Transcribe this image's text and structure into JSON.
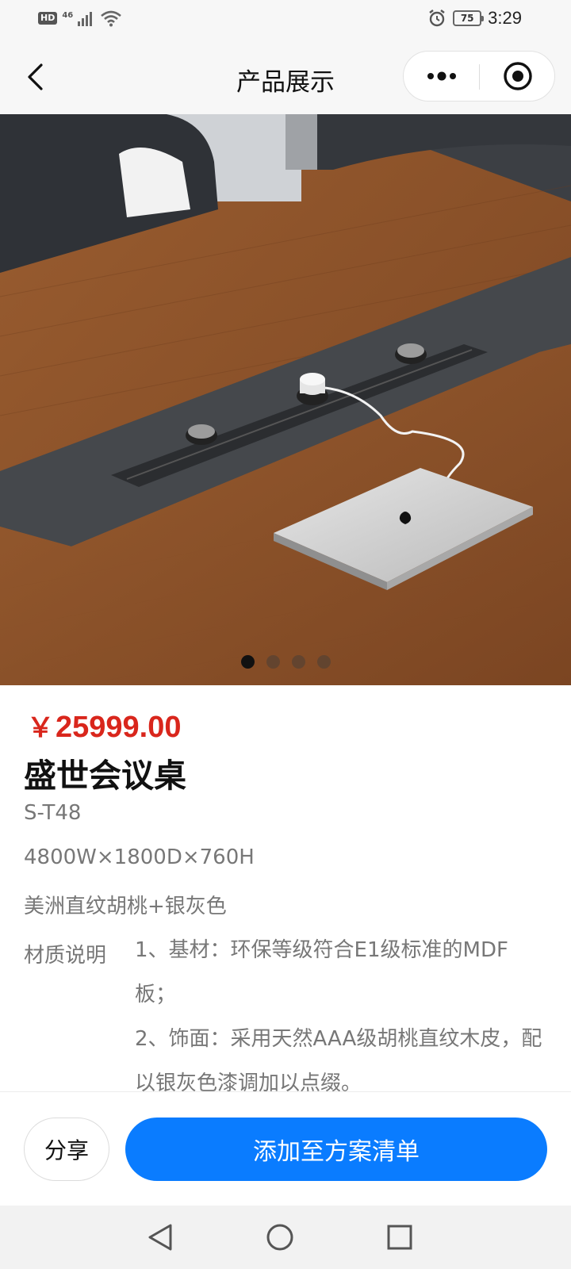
{
  "status_bar": {
    "hd": "HD",
    "network": "46",
    "battery": "75",
    "time": "3:29"
  },
  "nav": {
    "title": "产品展示",
    "icons": [
      "chevron-left-icon",
      "more-dots-icon",
      "target-close-icon"
    ]
  },
  "gallery": {
    "total_images": 4,
    "active_index": 0
  },
  "product": {
    "currency": "￥",
    "price": "25999.00",
    "name": "盛世会议桌",
    "model": "S-T48",
    "size": "4800W×1800D×760H",
    "color": "美洲直纹胡桃+银灰色",
    "material_label": "材质说明",
    "material_lines": [
      "1、基材：环保等级符合E1级标准的MDF板；",
      "2、饰面：采用天然AAA级胡桃直纹木皮，配以银灰色漆调加以点缀。"
    ]
  },
  "actions": {
    "share_label": "分享",
    "add_label": "添加至方案清单"
  },
  "colors": {
    "price_red": "#d9261c",
    "primary_blue": "#0a7cff"
  }
}
